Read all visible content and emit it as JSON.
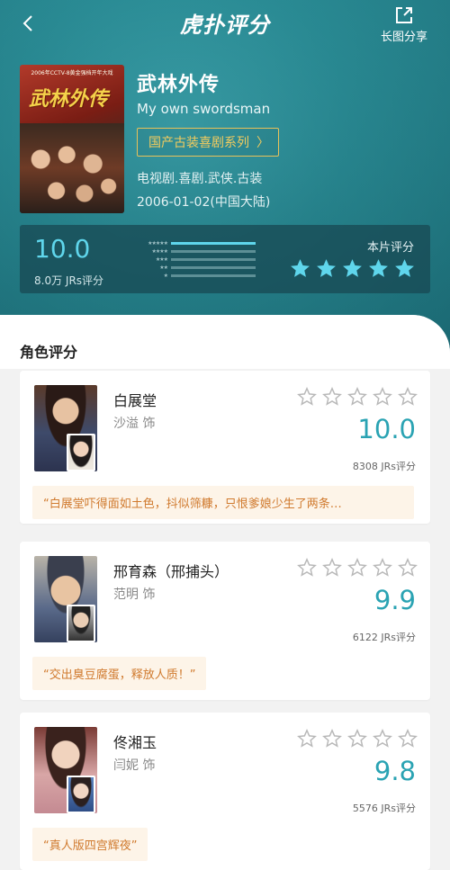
{
  "header": {
    "logo_text": "虎扑评分",
    "share_label": "长图分享"
  },
  "show": {
    "title_cn": "武林外传",
    "title_en": "My own swordsman",
    "series_button": "国产古装喜剧系列",
    "genres": "电视剧.喜剧.武侠.古装",
    "release": "2006-01-02(中国大陆)",
    "poster_banner": "2006年CCTV-8黄金强档开年大戏",
    "poster_title": "武林外传"
  },
  "rating": {
    "score": "10.0",
    "count": "8.0万 JRs评分",
    "my_label": "本片评分",
    "my_stars": 5,
    "distribution": [
      {
        "stars": "★★★★★",
        "fill": 1.0
      },
      {
        "stars": "★★★★",
        "fill": 0.0
      },
      {
        "stars": "★★★",
        "fill": 0.0
      },
      {
        "stars": "★★",
        "fill": 0.0
      },
      {
        "stars": "★",
        "fill": 0.0
      }
    ]
  },
  "roles_section": {
    "title": "角色评分",
    "cards": [
      {
        "role": "白展堂",
        "actor": "沙溢 饰",
        "score": "10.0",
        "count": "8308 JRs评分",
        "quote": "“白展堂吓得面如土色，抖似筛糠，只恨爹娘少生了两条…"
      },
      {
        "role": "邢育森（邢捕头）",
        "actor": "范明 饰",
        "score": "9.9",
        "count": "6122 JRs评分",
        "quote": "“交出臭豆腐蛋，释放人质！”"
      },
      {
        "role": "佟湘玉",
        "actor": "闫妮 饰",
        "score": "9.8",
        "count": "5576 JRs评分",
        "quote": "“真人版四宫辉夜”"
      }
    ]
  },
  "colors": {
    "accent": "#2aa3b3",
    "star_active": "#5fd6ec",
    "series_gold": "#e8c25a",
    "quote_text": "#d07a2e",
    "quote_bg": "#fdf4e8"
  },
  "icons": [
    "back-arrow-icon",
    "share-icon",
    "star-icon"
  ]
}
